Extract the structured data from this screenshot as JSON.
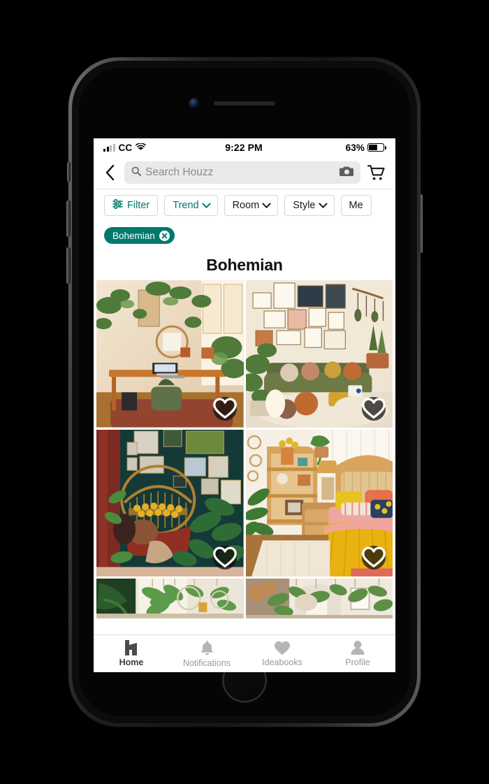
{
  "device": {
    "kind": "smartphone",
    "frame_color": "#2a2c2f"
  },
  "status_bar": {
    "carrier": "CC",
    "signal_icon": "cellular-bars-icon",
    "wifi_icon": "wifi-icon",
    "time": "9:22 PM",
    "battery_percent": "63%",
    "battery_icon": "battery-icon",
    "battery_level": 63
  },
  "navbar": {
    "back_icon": "chevron-left-icon",
    "search": {
      "icon": "search-icon",
      "placeholder": "Search Houzz",
      "value": "",
      "camera_icon": "camera-icon"
    },
    "cart_icon": "shopping-cart-icon"
  },
  "filter_bar": {
    "chips": [
      {
        "label": "Filter",
        "icon": "tune-sliders-icon",
        "has_chevron": false,
        "accent": true
      },
      {
        "label": "Trend",
        "icon": "",
        "has_chevron": true,
        "accent": true
      },
      {
        "label": "Room",
        "icon": "",
        "has_chevron": true,
        "accent": false
      },
      {
        "label": "Style",
        "icon": "",
        "has_chevron": true,
        "accent": false
      },
      {
        "label": "Me",
        "icon": "",
        "has_chevron": false,
        "accent": false
      }
    ]
  },
  "applied_filters": [
    {
      "label": "Bohemian",
      "remove_icon": "close-circle-icon",
      "color": "#00796B"
    }
  ],
  "page_title": "Bohemian",
  "photo_grid": {
    "favorite_icon": "heart-outline-icon",
    "items": [
      {
        "alt": "Boho home office with wooden desk, laptop and many hanging plants",
        "favorited": false
      },
      {
        "alt": "Living room with green velvet sofa, gallery wall and floor cushions",
        "favorited": false
      },
      {
        "alt": "Dark teal room with rattan hanging egg chair and framed art wall",
        "favorited": false
      },
      {
        "alt": "Bright bedroom with rattan headboard and yellow quilted bedspread",
        "favorited": false
      },
      {
        "alt": "Sunlit corner with hanging macrame planters and trailing greenery",
        "favorited": false
      },
      {
        "alt": "Open room with arched doorway and suspended hanging plants",
        "favorited": false
      }
    ]
  },
  "tab_bar": {
    "tabs": [
      {
        "label": "Home",
        "icon": "houzz-home-icon",
        "active": true
      },
      {
        "label": "Notifications",
        "icon": "bell-icon",
        "active": false
      },
      {
        "label": "Ideabooks",
        "icon": "heart-filled-icon",
        "active": false
      },
      {
        "label": "Profile",
        "icon": "person-icon",
        "active": false
      }
    ]
  },
  "colors": {
    "accent_green": "#00796B",
    "status_dark": "#101010",
    "muted_gray": "#9a9a9a"
  }
}
